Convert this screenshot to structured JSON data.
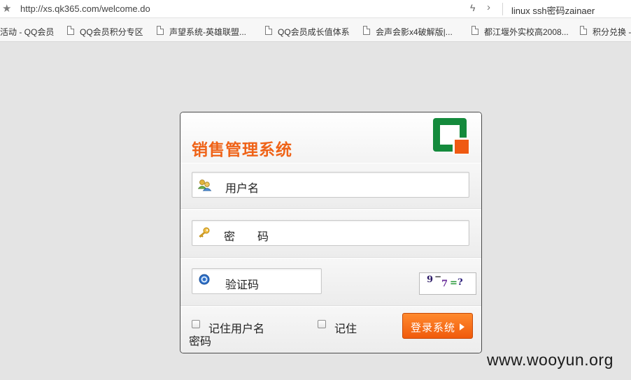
{
  "browser": {
    "url": "http://xs.qk365.com/welcome.do",
    "search_text": "linux ssh密码zainaer",
    "bookmarks": [
      "活动 - QQ会员",
      "QQ会员积分专区",
      "声望系统-英雄联盟...",
      "QQ会员成长值体系",
      "会声会影x4破解版|...",
      "都江堰外实校高2008...",
      "积分兑换 -"
    ]
  },
  "login": {
    "title": "销售管理系统",
    "username_placeholder": "用户名",
    "password_placeholder": "密　　码",
    "captcha_placeholder": "验证码",
    "captcha_text": [
      "9",
      "−",
      "7",
      "=",
      "?"
    ],
    "remember_username": "记住用户名",
    "remember_password_1": "记住",
    "remember_password_2": "密码",
    "login_button": "登录系统"
  },
  "colors": {
    "title": "#ef6318",
    "logo_green": "#148a3c",
    "logo_orange": "#ef5a12",
    "button": "#f05a0c"
  },
  "watermark": "www.wooyun.org"
}
